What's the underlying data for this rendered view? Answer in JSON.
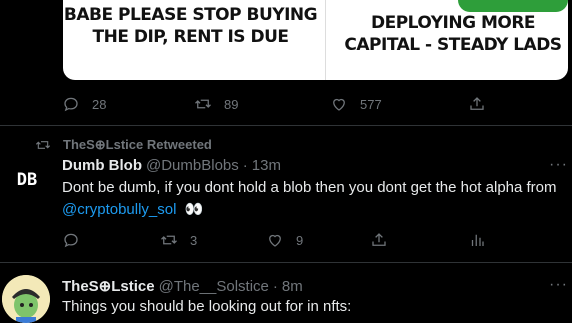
{
  "meme": {
    "left_text": "BABE PLEASE STOP BUYING THE DIP, RENT IS DUE",
    "right_text": "DEPLOYING MORE CAPITAL - STEADY LADS"
  },
  "tweet1_actions": {
    "reply_count": "28",
    "retweet_count": "89",
    "like_count": "577"
  },
  "retweet_banner": {
    "text": "TheS⊕Lstice Retweeted"
  },
  "tweet2": {
    "avatar_text": "DB",
    "name": "Dumb Blob",
    "handle": "@DumbBlobs",
    "dot": "·",
    "time": "13m",
    "text": "Dont be dumb, if you dont hold a blob then you dont get the hot alpha from",
    "mention": "@cryptobully_sol",
    "emoji": "👀",
    "reply_count": "",
    "retweet_count": "3",
    "like_count": "9"
  },
  "tweet3": {
    "name": "TheS⊕Lstice",
    "handle": "@The__Solstice",
    "dot": "·",
    "time": "8m",
    "text": "Things you should be looking out for in nfts:"
  },
  "more_label": "···"
}
